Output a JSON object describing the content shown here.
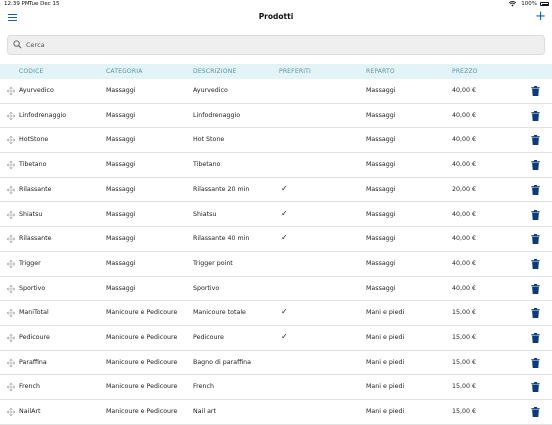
{
  "status_bar": {
    "time": "12:39 PM",
    "date": "Tue Dec 15",
    "battery": "100%"
  },
  "nav": {
    "title": "Prodotti",
    "add_label": "+"
  },
  "search": {
    "placeholder": "Cerca",
    "value": ""
  },
  "columns": [
    "CODICE",
    "CATEGORIA",
    "DESCRIZIONE",
    "PREFERITI",
    "REPARTO",
    "PREZZO"
  ],
  "rows": [
    {
      "codice": "Ayurvedico",
      "categoria": "Massaggi",
      "descrizione": "Ayurvedico",
      "preferito": "",
      "reparto": "Massaggi",
      "prezzo": "40,00 €"
    },
    {
      "codice": "Linfodrenaggio",
      "categoria": "Massaggi",
      "descrizione": "Linfodrenaggio",
      "preferito": "",
      "reparto": "Massaggi",
      "prezzo": "40,00 €"
    },
    {
      "codice": "HotStone",
      "categoria": "Massaggi",
      "descrizione": "Hot Stone",
      "preferito": "",
      "reparto": "Massaggi",
      "prezzo": "40,00 €"
    },
    {
      "codice": "Tibetano",
      "categoria": "Massaggi",
      "descrizione": "Tibetano",
      "preferito": "",
      "reparto": "Massaggi",
      "prezzo": "40,00 €"
    },
    {
      "codice": "Rilassante",
      "categoria": "Massaggi",
      "descrizione": "Rilassante 20 min",
      "preferito": "✓",
      "reparto": "Massaggi",
      "prezzo": "20,00 €"
    },
    {
      "codice": "Shiatsu",
      "categoria": "Massaggi",
      "descrizione": "Shiatsu",
      "preferito": "✓",
      "reparto": "Massaggi",
      "prezzo": "40,00 €"
    },
    {
      "codice": "Rilassante",
      "categoria": "Massaggi",
      "descrizione": "Rilassante 40 min",
      "preferito": "✓",
      "reparto": "Massaggi",
      "prezzo": "40,00 €"
    },
    {
      "codice": "Trigger",
      "categoria": "Massaggi",
      "descrizione": "Trigger point",
      "preferito": "",
      "reparto": "Massaggi",
      "prezzo": "40,00 €"
    },
    {
      "codice": "Sportivo",
      "categoria": "Massaggi",
      "descrizione": "Sportivo",
      "preferito": "",
      "reparto": "Massaggi",
      "prezzo": "40,00 €"
    },
    {
      "codice": "ManiTotal",
      "categoria": "Manicoure e Pedicoure",
      "descrizione": "Manicoure totale",
      "preferito": "✓",
      "reparto": "Mani e piedi",
      "prezzo": "15,00 €"
    },
    {
      "codice": "Pedicoure",
      "categoria": "Manicoure e Pedicoure",
      "descrizione": "Pedicoure",
      "preferito": "✓",
      "reparto": "Mani e piedi",
      "prezzo": "15,00 €"
    },
    {
      "codice": "Paraffina",
      "categoria": "Manicoure e Pedicoure",
      "descrizione": "Bagno di paraffina",
      "preferito": "",
      "reparto": "Mani e piedi",
      "prezzo": "15,00 €"
    },
    {
      "codice": "French",
      "categoria": "Manicoure e Pedicoure",
      "descrizione": "French",
      "preferito": "",
      "reparto": "Mani e piedi",
      "prezzo": "15,00 €"
    },
    {
      "codice": "NailArt",
      "categoria": "Manicoure e Pedicoure",
      "descrizione": "Nail art",
      "preferito": "",
      "reparto": "Mani e piedi",
      "prezzo": "15,00 €"
    }
  ],
  "icons": {
    "menu": "hamburger-icon",
    "add": "plus-icon",
    "search": "search-icon",
    "drag": "drag-handle-icon",
    "delete": "trash-icon",
    "favorite": "checkmark-icon"
  },
  "colors": {
    "accent": "#1c5fa8",
    "header_bg": "#e3f4f8",
    "header_text": "#5a8fa0",
    "trash": "#0d3b7a"
  }
}
